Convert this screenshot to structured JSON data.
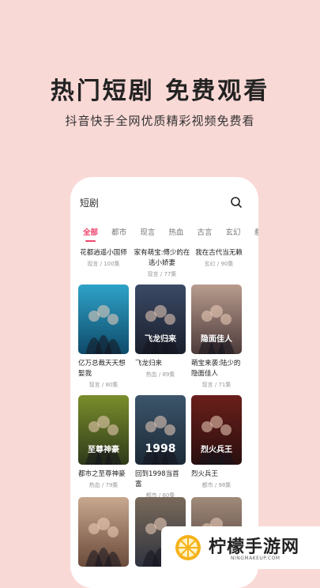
{
  "promo": {
    "title": "热门短剧 免费观看",
    "subtitle": "抖音快手全网优质精彩视频免费看"
  },
  "search": {
    "label": "短剧",
    "icon": "search-icon"
  },
  "tabs": [
    "全部",
    "都市",
    "现言",
    "热血",
    "古言",
    "玄幻",
    "悬"
  ],
  "top_row": [
    {
      "title": "花都逍遥小国师",
      "meta": "现言 / 100集"
    },
    {
      "title": "家有萌宝:傅少的在逃小娇妻",
      "meta": "现言 / 77集"
    },
    {
      "title": "我在古代当无赖",
      "meta": "玄幻 / 90集"
    }
  ],
  "grid": [
    {
      "title": "亿万总裁天天想娶我",
      "meta": "现言 / 80集",
      "poster_text": "",
      "colors": [
        "#0e4a6a",
        "#2fa3c8"
      ]
    },
    {
      "title": "飞龙归来",
      "meta": "热血 / 89集",
      "poster_text": "飞龙归来",
      "colors": [
        "#1a1f2c",
        "#3b4a66"
      ]
    },
    {
      "title": "萌宝来袭:陆少的隐面佳人",
      "meta": "现言 / 71集",
      "poster_text": "隐面佳人",
      "colors": [
        "#4d3a3a",
        "#b89c8e"
      ]
    },
    {
      "title": "都市之至尊神豪",
      "meta": "热血 / 79集",
      "poster_text": "至尊神豪",
      "colors": [
        "#2f3a1a",
        "#7a8e2c"
      ]
    },
    {
      "title": "回到1998当首富",
      "meta": "都市 / 60集",
      "poster_text": "1998",
      "colors": [
        "#1c2a36",
        "#3c556b"
      ]
    },
    {
      "title": "烈火兵王",
      "meta": "都市 / 98集",
      "poster_text": "烈火兵王",
      "colors": [
        "#2a0f0f",
        "#6a1f1a"
      ]
    },
    {
      "title": "",
      "meta": "",
      "poster_text": "",
      "colors": [
        "#6a4a3a",
        "#c8a88e"
      ]
    },
    {
      "title": "",
      "meta": "",
      "poster_text": "",
      "colors": [
        "#2f3340",
        "#7a6a5a"
      ]
    },
    {
      "title": "",
      "meta": "",
      "poster_text": "",
      "colors": [
        "#4a3a38",
        "#a08a7a"
      ]
    }
  ],
  "watermark": {
    "text": "柠檬手游网",
    "url": "NINGMAKEUP.COM"
  },
  "colors": {
    "accent": "#f0456e",
    "background": "#f9d9d6"
  }
}
